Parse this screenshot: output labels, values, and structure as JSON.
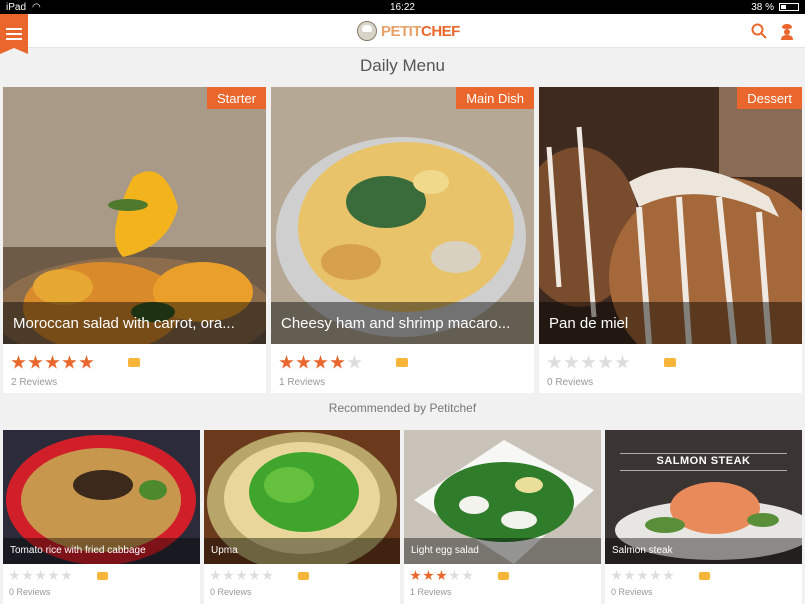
{
  "status": {
    "device": "iPad",
    "time": "16:22",
    "battery": "38 %"
  },
  "app": {
    "logo_a": "PETIT",
    "logo_b": "CHEF"
  },
  "daily": {
    "title": "Daily Menu",
    "cards": [
      {
        "tag": "Starter",
        "name": "Moroccan salad with carrot, ora...",
        "stars": 5,
        "reviews": "2 Reviews"
      },
      {
        "tag": "Main Dish",
        "name": "Cheesy ham and shrimp macaro...",
        "stars": 4,
        "reviews": "1 Reviews"
      },
      {
        "tag": "Dessert",
        "name": "Pan de miel",
        "stars": 0,
        "reviews": "0 Reviews"
      }
    ]
  },
  "recommended": {
    "title": "Recommended by Petitchef",
    "items": [
      {
        "name": "Tomato rice with fried cabbage",
        "stars": 0,
        "reviews": "0 Reviews"
      },
      {
        "name": "Upma",
        "stars": 0,
        "reviews": "0 Reviews"
      },
      {
        "name": "Light egg salad",
        "stars": 3,
        "reviews": "1 Reviews"
      },
      {
        "name": "Salmon steak",
        "stars": 0,
        "reviews": "0 Reviews",
        "banner": "SALMON STEAK"
      }
    ]
  },
  "colors": {
    "accent": "#e9672c",
    "comment": "#f7b53a"
  }
}
